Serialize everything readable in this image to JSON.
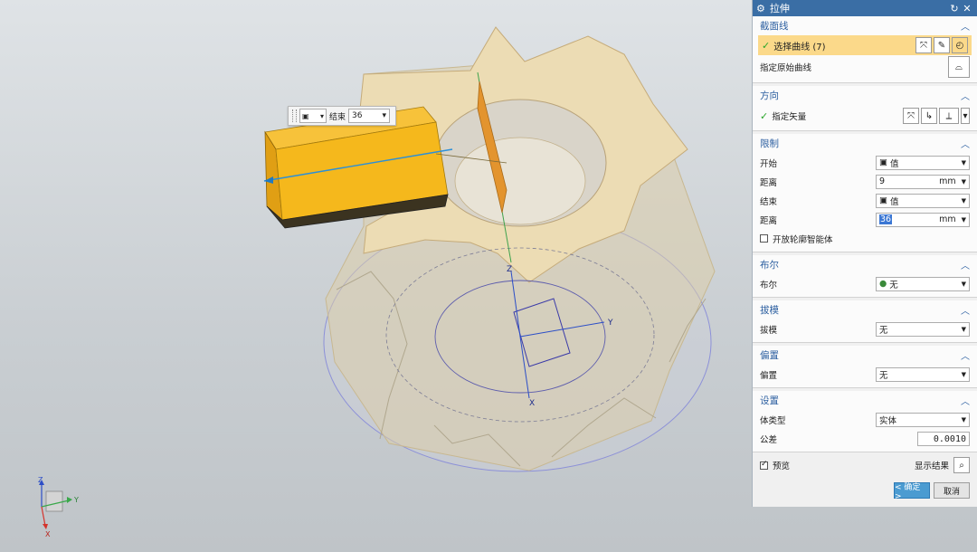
{
  "floating_bar": {
    "label": "结束",
    "value": "36"
  },
  "triad": {
    "z": "Z",
    "y": "Y",
    "x": "X"
  },
  "wcs": {
    "z": "Z",
    "y": "Y",
    "x": "X"
  },
  "dialog": {
    "title": "拉伸",
    "section_curve": {
      "title": "截面线",
      "select_label": "选择曲线 (7)",
      "specify_label": "指定原始曲线"
    },
    "section_direction": {
      "title": "方向",
      "vector_label": "指定矢量"
    },
    "section_limits": {
      "title": "限制",
      "start_label": "开始",
      "start_value": "值",
      "distance_label": "距离",
      "start_distance": "9",
      "unit": "mm",
      "end_label": "结束",
      "end_value": "值",
      "end_distance": "36",
      "open_profile_label": "开放轮廓智能体"
    },
    "section_boolean": {
      "title": "布尔",
      "boolean_label": "布尔",
      "boolean_value": "无"
    },
    "section_draft": {
      "title": "拔模",
      "draft_label": "拔模",
      "draft_value": "无"
    },
    "section_offset": {
      "title": "偏置",
      "offset_label": "偏置",
      "offset_value": "无"
    },
    "section_settings": {
      "title": "设置",
      "body_type_label": "体类型",
      "body_type_value": "实体",
      "tolerance_label": "公差",
      "tolerance_value": "0.0010"
    },
    "preview_label": "预览",
    "show_result_label": "显示结果",
    "ok_label": "< 确定 >",
    "cancel_label": "取消"
  },
  "colors": {
    "title_bar": "#3a6ea5",
    "section_header": "#2c5fa0",
    "selection_highlight": "#fbd98a",
    "extrude_body": "#f5b81c",
    "gear_body": "#ecdcb4",
    "ok_button": "#4b9bd1"
  }
}
